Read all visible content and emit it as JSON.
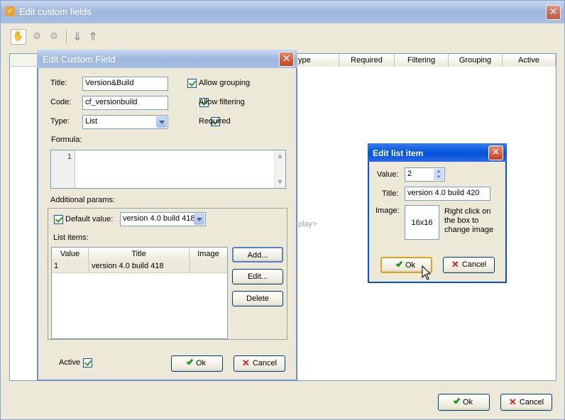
{
  "main_window": {
    "title": "Edit custom fields",
    "columns": [
      "ype",
      "Required",
      "Filtering",
      "Grouping",
      "Active"
    ],
    "background_hint": "play>",
    "ok_label": "Ok",
    "cancel_label": "Cancel"
  },
  "edit_field_dialog": {
    "title": "Edit Custom Field",
    "title_label": "Title:",
    "title_value": "Version&Build",
    "code_label": "Code:",
    "code_value": "cf_versionbuild",
    "type_label": "Type:",
    "type_value": "List",
    "allow_grouping_label": "Allow grouping",
    "allow_filtering_label": "Allow filtering",
    "required_label": "Required",
    "formula_label": "Formula:",
    "formula_line": "1",
    "additional_params_label": "Additional params:",
    "default_value_label": "Default value:",
    "default_value": "version 4.0 build 418",
    "list_items_label": "List items:",
    "list_columns": [
      "Value",
      "Title",
      "Image"
    ],
    "list_rows": [
      {
        "value": "1",
        "title": "version 4.0 build 418",
        "image": ""
      }
    ],
    "add_label": "Add...",
    "edit_label": "Edit...",
    "delete_label": "Delete",
    "active_label": "Active",
    "ok_label": "Ok",
    "cancel_label": "Cancel"
  },
  "edit_list_item_dialog": {
    "title": "Edit list item",
    "value_label": "Value:",
    "value": "2",
    "title_label": "Title:",
    "title_value": "version 4.0 build 420",
    "image_label": "Image:",
    "image_placeholder": "16x16",
    "image_hint": "Right click on the box to change image",
    "ok_label": "Ok",
    "cancel_label": "Cancel"
  }
}
